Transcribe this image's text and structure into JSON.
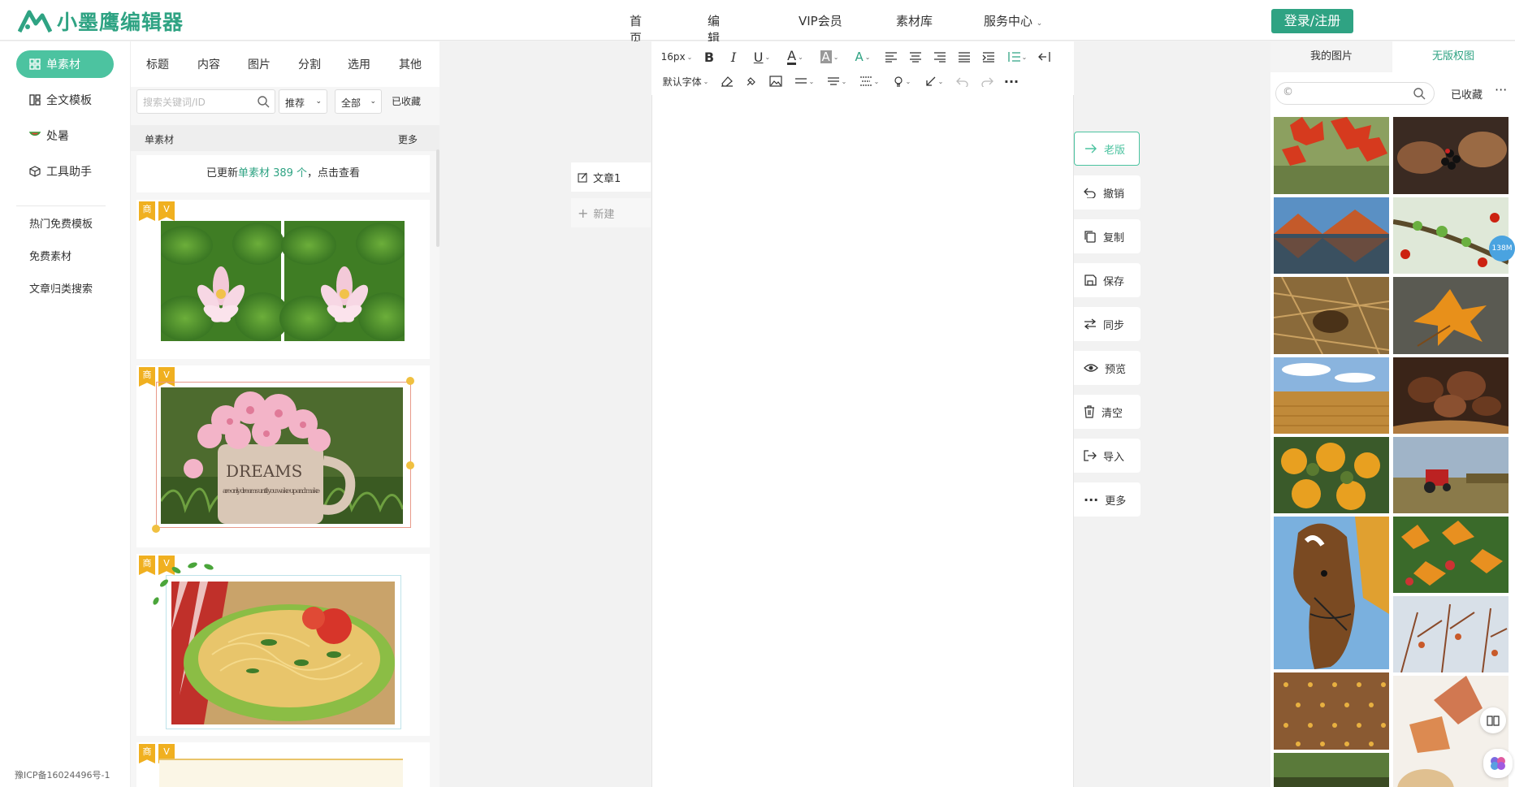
{
  "header": {
    "logo_text": "小墨鹰编辑器",
    "nav": [
      "首页",
      "编辑器",
      "VIP会员",
      "素材库",
      "服务中心"
    ],
    "login": "登录/注册"
  },
  "left_nav": {
    "items": [
      "单素材",
      "全文模板",
      "处暑",
      "工具助手"
    ],
    "links": [
      "热门免费模板",
      "免费素材",
      "文章归类搜索"
    ],
    "icp": "豫ICP备16024496号-1"
  },
  "materials": {
    "categories": [
      "标题",
      "内容",
      "图片",
      "分割",
      "选用",
      "其他"
    ],
    "search_placeholder": "搜索关键词/ID",
    "filter_sort": "推荐",
    "filter_scope": "全部",
    "favorites": "已收藏",
    "section_title": "单素材",
    "section_more": "更多",
    "updated_prefix": "已更新",
    "updated_link": "单素材 389 个",
    "updated_suffix": "，点击查看",
    "badge_shang": "商",
    "badge_v": "V",
    "card_text": {
      "dreams": "DREAMS",
      "dreams_small": "are only dreams until you wake up and make"
    }
  },
  "editor": {
    "font_size": "16px",
    "font_family": "默认字体",
    "doc_tab": "文章1",
    "new_doc": "新建"
  },
  "side_actions": [
    "老版",
    "撤销",
    "复制",
    "保存",
    "同步",
    "预览",
    "清空",
    "导入",
    "更多"
  ],
  "right_panel": {
    "tabs": [
      "我的图片",
      "无版权图"
    ],
    "favorites": "已收藏",
    "memory_badge": "138M"
  },
  "colors": {
    "brand": "#2fa383",
    "accent": "#4cc3a0"
  }
}
